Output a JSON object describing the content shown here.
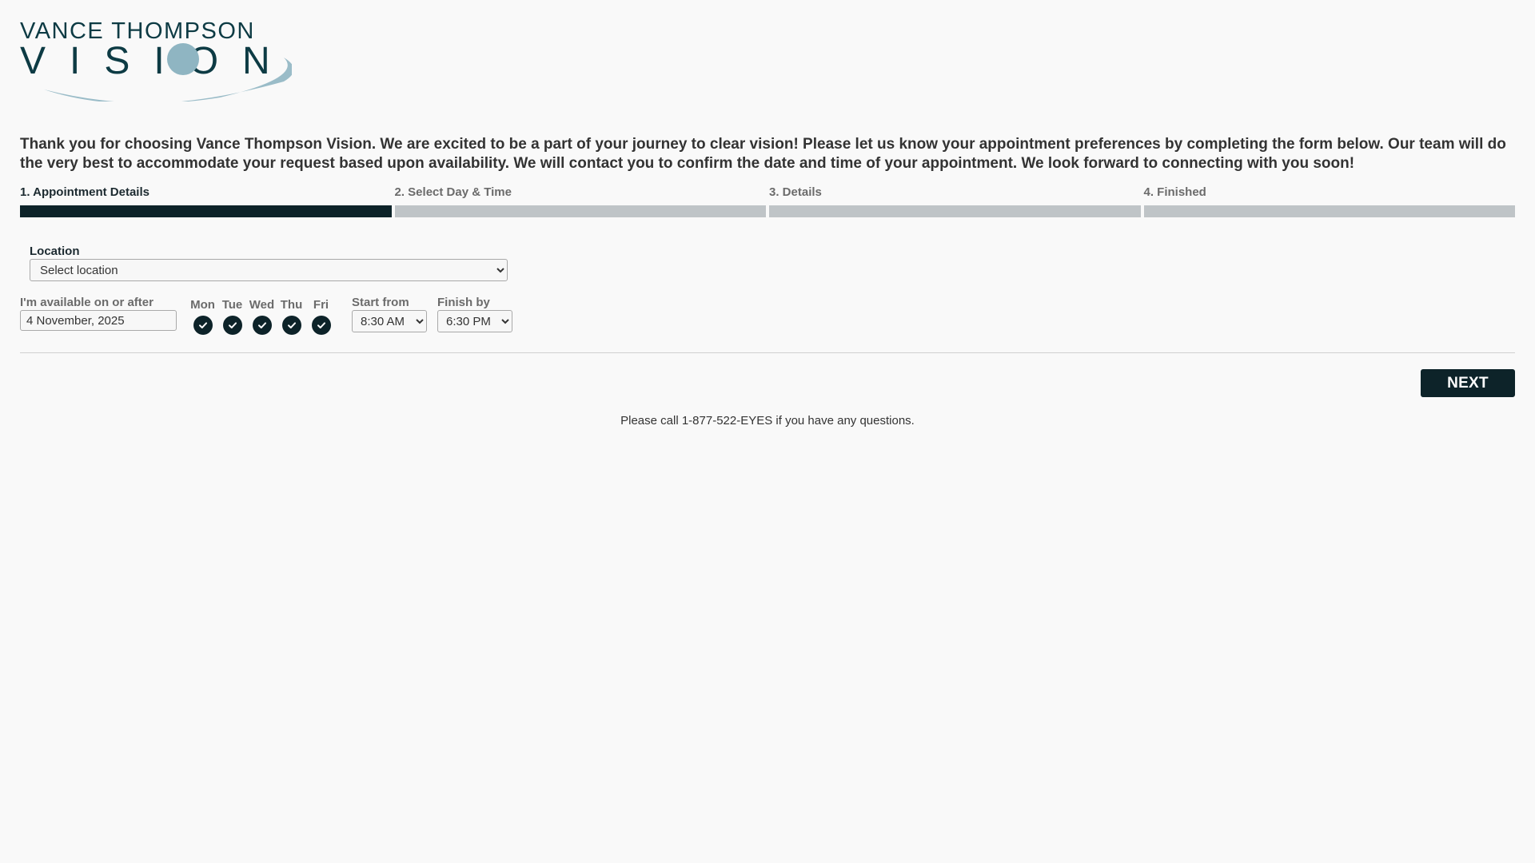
{
  "brand": {
    "line1": "VANCE THOMPSON",
    "line2": "VISION",
    "colors": {
      "dark": "#0d3b44",
      "accent": "#8fb5c2"
    }
  },
  "intro": {
    "text": "Thank you for choosing Vance Thompson Vision. We are excited to be a part of your journey to clear vision!  Please let us know your appointment preferences by completing the form below. Our team will do the very best to accommodate your request based upon availability. We will contact you to confirm the date and time of your appointment. We look forward to connecting with you soon!"
  },
  "steps": [
    {
      "label": "1. Appointment Details",
      "active": true
    },
    {
      "label": "2. Select Day & Time",
      "active": false
    },
    {
      "label": "3. Details",
      "active": false
    },
    {
      "label": "4. Finished",
      "active": false
    }
  ],
  "location": {
    "label": "Location",
    "selected": "Select location"
  },
  "availability": {
    "label": "I'm available on or after",
    "date_value": "4 November, 2025"
  },
  "days": [
    {
      "label": "Mon",
      "checked": true,
      "icon": "check-icon"
    },
    {
      "label": "Tue",
      "checked": true,
      "icon": "check-icon"
    },
    {
      "label": "Wed",
      "checked": true,
      "icon": "check-icon"
    },
    {
      "label": "Thu",
      "checked": true,
      "icon": "check-icon"
    },
    {
      "label": "Fri",
      "checked": true,
      "icon": "check-icon"
    }
  ],
  "start_time": {
    "label": "Start from",
    "selected": "8:30 AM"
  },
  "finish_time": {
    "label": "Finish by",
    "selected": "6:30 PM"
  },
  "actions": {
    "next_label": "NEXT"
  },
  "footer": {
    "note": "Please call 1-877-522-EYES if you have any questions."
  },
  "colors": {
    "primary": "#0d2329",
    "inactive_bar": "#bfc4c7",
    "background": "#f9f9f9"
  }
}
